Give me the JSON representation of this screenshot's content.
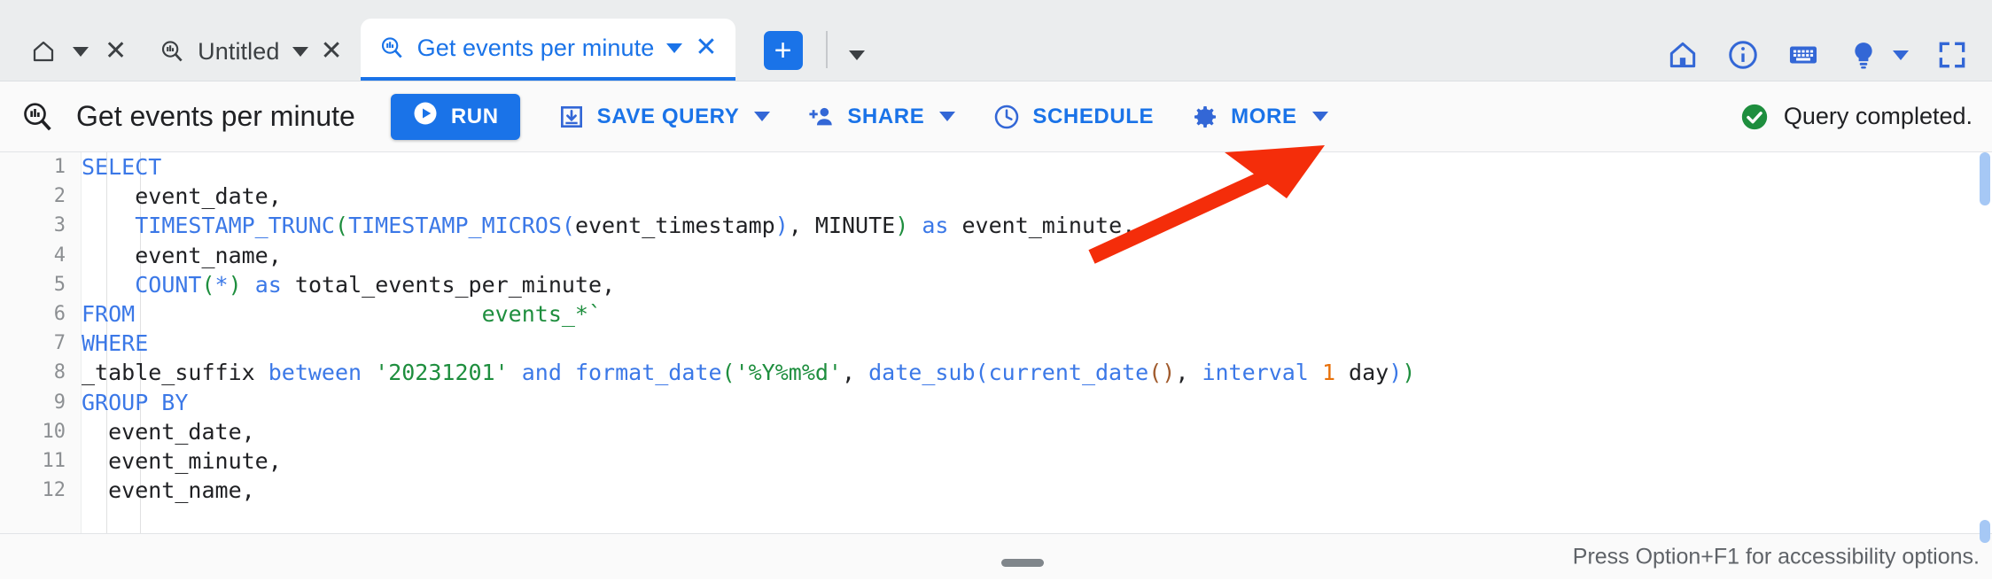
{
  "tabbar": {
    "tabs": [
      {
        "id": "home",
        "icon": "home-icon",
        "label": "",
        "has_caret": true,
        "has_close": true,
        "active": false
      },
      {
        "id": "untitled",
        "icon": "query-icon",
        "label": "Untitled",
        "has_caret": true,
        "has_close": true,
        "active": false
      },
      {
        "id": "events",
        "icon": "query-icon",
        "label": "Get events per minute",
        "has_caret": true,
        "has_close": true,
        "active": true
      }
    ],
    "close_glyph": "✕",
    "new_tab_button": {
      "label": "+",
      "name": "new-tab-button"
    },
    "tab_list_caret": "caret-down-icon",
    "right_icons": [
      {
        "name": "home-icon",
        "label": "Home"
      },
      {
        "name": "info-icon",
        "label": "Info"
      },
      {
        "name": "keyboard-icon",
        "label": "Keyboard shortcuts"
      },
      {
        "name": "lightbulb-icon",
        "label": "Tips"
      },
      {
        "name": "fullscreen-icon",
        "label": "Full screen"
      }
    ]
  },
  "toolbar": {
    "query_icon": "query-icon",
    "title": "Get events per minute",
    "run_label": "RUN",
    "save_label": "SAVE QUERY",
    "share_label": "SHARE",
    "schedule_label": "SCHEDULE",
    "more_label": "MORE",
    "status_text": "Query completed.",
    "status_icon": "check-circle-icon",
    "accent_blue": "#1a73e8",
    "status_green": "#1e8e3e"
  },
  "editor": {
    "lines": [
      {
        "n": "1",
        "tokens": [
          {
            "t": "SELECT",
            "c": "kw"
          }
        ]
      },
      {
        "n": "2",
        "tokens": [
          {
            "t": "    event_date,",
            "c": ""
          }
        ]
      },
      {
        "n": "3",
        "tokens": [
          {
            "t": "    ",
            "c": ""
          },
          {
            "t": "TIMESTAMP_TRUNC",
            "c": "fn"
          },
          {
            "t": "(",
            "c": "p1"
          },
          {
            "t": "TIMESTAMP_MICROS",
            "c": "fn"
          },
          {
            "t": "(",
            "c": "p2"
          },
          {
            "t": "event_timestamp",
            "c": ""
          },
          {
            "t": ")",
            "c": "p2"
          },
          {
            "t": ", MINUTE",
            "c": ""
          },
          {
            "t": ")",
            "c": "p1"
          },
          {
            "t": " ",
            "c": ""
          },
          {
            "t": "as",
            "c": "kw"
          },
          {
            "t": " event_minute,",
            "c": ""
          }
        ]
      },
      {
        "n": "4",
        "tokens": [
          {
            "t": "    event_name,",
            "c": ""
          }
        ]
      },
      {
        "n": "5",
        "tokens": [
          {
            "t": "    ",
            "c": ""
          },
          {
            "t": "COUNT",
            "c": "fn"
          },
          {
            "t": "(",
            "c": "p1"
          },
          {
            "t": "*",
            "c": "p2"
          },
          {
            "t": ")",
            "c": "p1"
          },
          {
            "t": " ",
            "c": ""
          },
          {
            "t": "as",
            "c": "kw"
          },
          {
            "t": " total_events_per_minute,",
            "c": ""
          }
        ]
      },
      {
        "n": "6",
        "tokens": [
          {
            "t": "FROM",
            "c": "kw"
          },
          {
            "t": "                          ",
            "c": ""
          },
          {
            "t": "events_*`",
            "c": "str"
          }
        ]
      },
      {
        "n": "7",
        "tokens": [
          {
            "t": "WHERE",
            "c": "kw"
          }
        ]
      },
      {
        "n": "8",
        "tokens": [
          {
            "t": "_table_suffix ",
            "c": ""
          },
          {
            "t": "between",
            "c": "kw"
          },
          {
            "t": " ",
            "c": ""
          },
          {
            "t": "'20231201'",
            "c": "str"
          },
          {
            "t": " ",
            "c": ""
          },
          {
            "t": "and",
            "c": "kw"
          },
          {
            "t": " ",
            "c": ""
          },
          {
            "t": "format_date",
            "c": "fn"
          },
          {
            "t": "(",
            "c": "p1"
          },
          {
            "t": "'%Y%m%d'",
            "c": "str"
          },
          {
            "t": ", ",
            "c": ""
          },
          {
            "t": "date_sub",
            "c": "fn"
          },
          {
            "t": "(",
            "c": "p2"
          },
          {
            "t": "current_date",
            "c": "fn"
          },
          {
            "t": "(",
            "c": "p3"
          },
          {
            "t": ")",
            "c": "p3"
          },
          {
            "t": ", ",
            "c": ""
          },
          {
            "t": "interval",
            "c": "kw"
          },
          {
            "t": " ",
            "c": ""
          },
          {
            "t": "1",
            "c": "num"
          },
          {
            "t": " day",
            "c": ""
          },
          {
            "t": ")",
            "c": "p2"
          },
          {
            "t": ")",
            "c": "p1"
          }
        ]
      },
      {
        "n": "9",
        "tokens": [
          {
            "t": "GROUP BY",
            "c": "kw"
          }
        ]
      },
      {
        "n": "10",
        "tokens": [
          {
            "t": "  event_date,",
            "c": ""
          }
        ]
      },
      {
        "n": "11",
        "tokens": [
          {
            "t": "  event_minute,",
            "c": ""
          }
        ]
      },
      {
        "n": "12",
        "tokens": [
          {
            "t": "  event_name,",
            "c": ""
          }
        ]
      }
    ]
  },
  "bottombar": {
    "accessibility_hint": "Press Option+F1 for accessibility options.",
    "drag_handle": "resize-handle"
  },
  "annotation": {
    "arrow_color": "#f42d0a",
    "points_to": "MORE"
  }
}
